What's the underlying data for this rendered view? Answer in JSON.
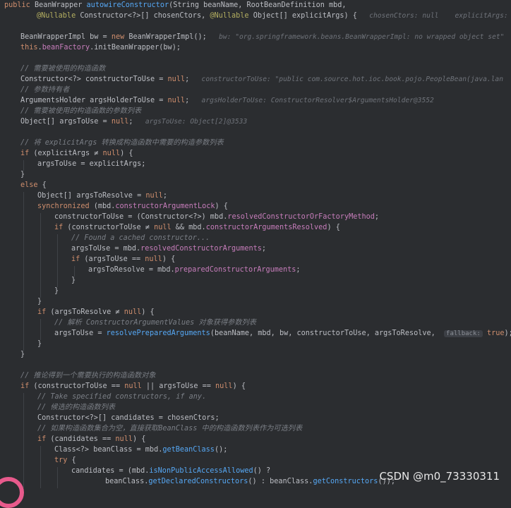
{
  "editor": {
    "lines": [
      {
        "y": 0,
        "indent": 6,
        "tokens": [
          {
            "t": "public ",
            "c": "kw"
          },
          {
            "t": "BeanWrapper ",
            "c": "type"
          },
          {
            "t": "autowireConstructor",
            "c": "fn"
          },
          {
            "t": "(String beanName, RootBeanDefinition mbd,",
            "c": "txt"
          }
        ]
      },
      {
        "y": 1,
        "indent": 52,
        "tokens": [
          {
            "t": "@Nullable ",
            "c": "ann"
          },
          {
            "t": "Constructor<?>[] chosenCtors, ",
            "c": "txt"
          },
          {
            "t": "@Nullable ",
            "c": "ann"
          },
          {
            "t": "Object[] explicitArgs) {",
            "c": "txt"
          },
          {
            "t": "   chosenCtors: null    explicitArgs: n",
            "c": "hint"
          }
        ]
      },
      {
        "y": 3,
        "indent": 29,
        "tokens": [
          {
            "t": "BeanWrapperImpl bw = ",
            "c": "txt"
          },
          {
            "t": "new ",
            "c": "kw"
          },
          {
            "t": "BeanWrapperImpl();",
            "c": "txt"
          },
          {
            "t": "   bw: \"org.springframework.beans.BeanWrapperImpl: no wrapped object set\"",
            "c": "hint"
          }
        ]
      },
      {
        "y": 4,
        "indent": 29,
        "tokens": [
          {
            "t": "this",
            "c": "kw"
          },
          {
            "t": ".",
            "c": "txt"
          },
          {
            "t": "beanFactory",
            "c": "field"
          },
          {
            "t": ".initBeanWrapper(bw);",
            "c": "txt"
          }
        ]
      },
      {
        "y": 6,
        "indent": 29,
        "tokens": [
          {
            "t": "// 需要被使用的构造函数",
            "c": "cm"
          }
        ]
      },
      {
        "y": 7,
        "indent": 29,
        "tokens": [
          {
            "t": "Constructor<?> constructorToUse = ",
            "c": "txt"
          },
          {
            "t": "null",
            "c": "kw"
          },
          {
            "t": ";",
            "c": "txt"
          },
          {
            "t": "   constructorToUse: \"public com.source.hot.ioc.book.pojo.PeopleBean(java.lan",
            "c": "hint"
          }
        ]
      },
      {
        "y": 8,
        "indent": 29,
        "tokens": [
          {
            "t": "// 参数持有者",
            "c": "cm"
          }
        ]
      },
      {
        "y": 9,
        "indent": 29,
        "tokens": [
          {
            "t": "ArgumentsHolder argsHolderToUse = ",
            "c": "txt"
          },
          {
            "t": "null",
            "c": "kw"
          },
          {
            "t": ";",
            "c": "txt"
          },
          {
            "t": "   argsHolderToUse: ConstructorResolver$ArgumentsHolder@3552",
            "c": "hint"
          }
        ]
      },
      {
        "y": 10,
        "indent": 29,
        "tokens": [
          {
            "t": "// 需要被使用的构造函数的参数列表",
            "c": "cm"
          }
        ]
      },
      {
        "y": 11,
        "indent": 29,
        "tokens": [
          {
            "t": "Object[] argsToUse = ",
            "c": "txt"
          },
          {
            "t": "null",
            "c": "kw"
          },
          {
            "t": ";",
            "c": "txt"
          },
          {
            "t": "   argsToUse: Object[2]@3533",
            "c": "hint"
          }
        ]
      },
      {
        "y": 13,
        "indent": 29,
        "tokens": [
          {
            "t": "// 将 explicitArgs 转换成构造函数中需要的构造参数列表",
            "c": "cm"
          }
        ]
      },
      {
        "y": 14,
        "indent": 29,
        "tokens": [
          {
            "t": "if ",
            "c": "kw"
          },
          {
            "t": "(explicitArgs ≠ ",
            "c": "txt"
          },
          {
            "t": "null",
            "c": "kw"
          },
          {
            "t": ") {",
            "c": "txt"
          }
        ]
      },
      {
        "y": 15,
        "indent": 53,
        "tokens": [
          {
            "t": "argsToUse = explicitArgs;",
            "c": "txt"
          }
        ]
      },
      {
        "y": 16,
        "indent": 29,
        "tokens": [
          {
            "t": "}",
            "c": "txt"
          }
        ]
      },
      {
        "y": 17,
        "indent": 29,
        "tokens": [
          {
            "t": "else ",
            "c": "kw"
          },
          {
            "t": "{",
            "c": "txt"
          }
        ]
      },
      {
        "y": 18,
        "indent": 53,
        "tokens": [
          {
            "t": "Object[] argsToResolve = ",
            "c": "txt"
          },
          {
            "t": "null",
            "c": "kw"
          },
          {
            "t": ";",
            "c": "txt"
          }
        ]
      },
      {
        "y": 19,
        "indent": 53,
        "tokens": [
          {
            "t": "synchronized ",
            "c": "kw"
          },
          {
            "t": "(mbd.",
            "c": "txt"
          },
          {
            "t": "constructorArgumentLock",
            "c": "field"
          },
          {
            "t": ") {",
            "c": "txt"
          }
        ]
      },
      {
        "y": 20,
        "indent": 77,
        "tokens": [
          {
            "t": "constructorToUse = (Constructor<?>) mbd.",
            "c": "txt"
          },
          {
            "t": "resolvedConstructorOrFactoryMethod",
            "c": "field"
          },
          {
            "t": ";",
            "c": "txt"
          }
        ]
      },
      {
        "y": 21,
        "indent": 77,
        "tokens": [
          {
            "t": "if ",
            "c": "kw"
          },
          {
            "t": "(constructorToUse ≠ ",
            "c": "txt"
          },
          {
            "t": "null ",
            "c": "kw"
          },
          {
            "t": "&& mbd.",
            "c": "txt"
          },
          {
            "t": "constructorArgumentsResolved",
            "c": "field"
          },
          {
            "t": ") {",
            "c": "txt"
          }
        ]
      },
      {
        "y": 22,
        "indent": 101,
        "tokens": [
          {
            "t": "// Found a cached constructor...",
            "c": "cm"
          }
        ]
      },
      {
        "y": 23,
        "indent": 101,
        "tokens": [
          {
            "t": "argsToUse = mbd.",
            "c": "txt"
          },
          {
            "t": "resolvedConstructorArguments",
            "c": "field"
          },
          {
            "t": ";",
            "c": "txt"
          }
        ]
      },
      {
        "y": 24,
        "indent": 101,
        "tokens": [
          {
            "t": "if ",
            "c": "kw"
          },
          {
            "t": "(argsToUse == ",
            "c": "txt"
          },
          {
            "t": "null",
            "c": "kw"
          },
          {
            "t": ") {",
            "c": "txt"
          }
        ]
      },
      {
        "y": 25,
        "indent": 125,
        "tokens": [
          {
            "t": "argsToResolve = mbd.",
            "c": "txt"
          },
          {
            "t": "preparedConstructorArguments",
            "c": "field"
          },
          {
            "t": ";",
            "c": "txt"
          }
        ]
      },
      {
        "y": 26,
        "indent": 101,
        "tokens": [
          {
            "t": "}",
            "c": "txt"
          }
        ]
      },
      {
        "y": 27,
        "indent": 77,
        "tokens": [
          {
            "t": "}",
            "c": "txt"
          }
        ]
      },
      {
        "y": 28,
        "indent": 53,
        "tokens": [
          {
            "t": "}",
            "c": "txt"
          }
        ]
      },
      {
        "y": 29,
        "indent": 53,
        "tokens": [
          {
            "t": "if ",
            "c": "kw"
          },
          {
            "t": "(argsToResolve ≠ ",
            "c": "txt"
          },
          {
            "t": "null",
            "c": "kw"
          },
          {
            "t": ") {",
            "c": "txt"
          }
        ]
      },
      {
        "y": 30,
        "indent": 77,
        "tokens": [
          {
            "t": "// 解析 ConstructorArgumentValues 对象获得参数列表",
            "c": "cm"
          }
        ]
      },
      {
        "y": 31,
        "indent": 77,
        "tokens": [
          {
            "t": "argsToUse = ",
            "c": "txt"
          },
          {
            "t": "resolvePreparedArguments",
            "c": "fn"
          },
          {
            "t": "(beanName, mbd, bw, constructorToUse, argsToResolve,  ",
            "c": "txt"
          },
          {
            "t": "fallback:",
            "c": "inlay"
          },
          {
            "t": " ",
            "c": "txt"
          },
          {
            "t": "true",
            "c": "kw"
          },
          {
            "t": ");",
            "c": "txt"
          }
        ]
      },
      {
        "y": 32,
        "indent": 53,
        "tokens": [
          {
            "t": "}",
            "c": "txt"
          }
        ]
      },
      {
        "y": 33,
        "indent": 29,
        "tokens": [
          {
            "t": "}",
            "c": "txt"
          }
        ]
      },
      {
        "y": 35,
        "indent": 29,
        "tokens": [
          {
            "t": "// 推论得到一个需要执行的构造函数对象",
            "c": "cm"
          }
        ]
      },
      {
        "y": 36,
        "indent": 29,
        "tokens": [
          {
            "t": "if ",
            "c": "kw"
          },
          {
            "t": "(constructorToUse == ",
            "c": "txt"
          },
          {
            "t": "null ",
            "c": "kw"
          },
          {
            "t": "|| argsToUse == ",
            "c": "txt"
          },
          {
            "t": "null",
            "c": "kw"
          },
          {
            "t": ") {",
            "c": "txt"
          }
        ]
      },
      {
        "y": 37,
        "indent": 53,
        "tokens": [
          {
            "t": "// Take specified constructors, if any.",
            "c": "cm"
          }
        ]
      },
      {
        "y": 38,
        "indent": 53,
        "tokens": [
          {
            "t": "// 候选的构造函数列表",
            "c": "cm"
          }
        ]
      },
      {
        "y": 39,
        "indent": 53,
        "tokens": [
          {
            "t": "Constructor<?>[] candidates = chosenCtors;",
            "c": "txt"
          }
        ]
      },
      {
        "y": 40,
        "indent": 53,
        "tokens": [
          {
            "t": "// 如果构造函数集合为空，直接获取BeanClass 中的构造函数列表作为可选列表",
            "c": "cm"
          }
        ]
      },
      {
        "y": 41,
        "indent": 53,
        "tokens": [
          {
            "t": "if ",
            "c": "kw"
          },
          {
            "t": "(candidates == ",
            "c": "txt"
          },
          {
            "t": "null",
            "c": "kw"
          },
          {
            "t": ") {",
            "c": "txt"
          }
        ]
      },
      {
        "y": 42,
        "indent": 77,
        "tokens": [
          {
            "t": "Class<?> beanClass = mbd.",
            "c": "txt"
          },
          {
            "t": "getBeanClass",
            "c": "fn"
          },
          {
            "t": "();",
            "c": "txt"
          }
        ]
      },
      {
        "y": 43,
        "indent": 77,
        "tokens": [
          {
            "t": "try ",
            "c": "kw"
          },
          {
            "t": "{",
            "c": "txt"
          }
        ]
      },
      {
        "y": 44,
        "indent": 101,
        "tokens": [
          {
            "t": "candidates = (mbd.",
            "c": "txt"
          },
          {
            "t": "isNonPublicAccessAllowed",
            "c": "fn"
          },
          {
            "t": "() ?",
            "c": "txt"
          }
        ]
      },
      {
        "y": 45,
        "indent": 149,
        "tokens": [
          {
            "t": "beanClass.",
            "c": "txt"
          },
          {
            "t": "getDeclaredConstructors",
            "c": "fn"
          },
          {
            "t": "() : beanClass.",
            "c": "txt"
          },
          {
            "t": "getConstructors",
            "c": "fn"
          },
          {
            "t": "());",
            "c": "txt"
          }
        ]
      }
    ]
  },
  "watermark": "CSDN @m0_73330311"
}
